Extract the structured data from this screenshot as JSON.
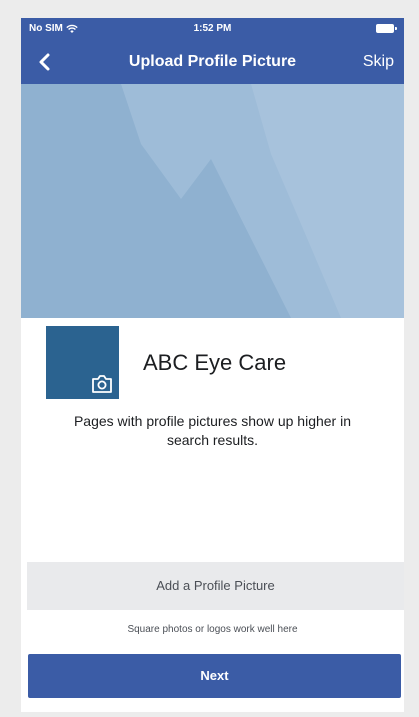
{
  "status_bar": {
    "carrier": "No SIM",
    "time": "1:52 PM"
  },
  "nav": {
    "title": "Upload Profile Picture",
    "skip_label": "Skip"
  },
  "page": {
    "name": "ABC Eye Care",
    "description": "Pages with profile pictures show up higher in search results."
  },
  "actions": {
    "add_picture_label": "Add a Profile Picture",
    "hint": "Square photos or logos work well here",
    "next_label": "Next"
  },
  "colors": {
    "brand": "#3b5ca6",
    "profile_placeholder": "#2b6390",
    "cover_placeholder": "#8fb1d0"
  },
  "icons": {
    "back": "chevron-left-icon",
    "camera": "camera-icon",
    "wifi": "wifi-icon",
    "battery": "battery-icon"
  }
}
